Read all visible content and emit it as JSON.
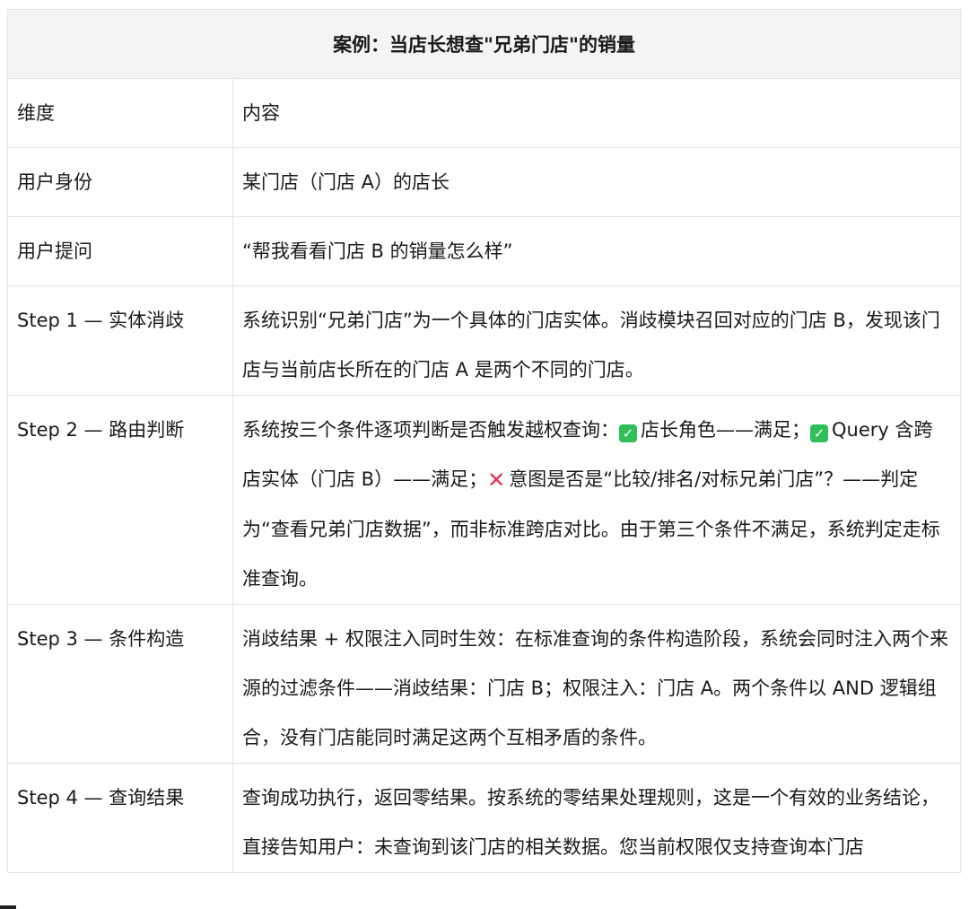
{
  "title": "案例：当店长想查\"兄弟门店\"的销量",
  "header": {
    "col1": "维度",
    "col2": "内容"
  },
  "rows": [
    {
      "label": "用户身份",
      "content": "某门店（门店 A）的店长"
    },
    {
      "label": "用户提问",
      "content": "“帮我看看门店 B 的销量怎么样”"
    },
    {
      "label": "Step 1 — 实体消歧",
      "content": "系统识别“兄弟门店”为一个具体的门店实体。消歧模块召回对应的门店 B，发现该门店与当前店长所在的门店 A 是两个不同的门店。"
    },
    {
      "label": "Step 2 — 路由判断",
      "part1": "系统按三个条件逐项判断是否触发越权查询：",
      "part2": "店长角色——满足；",
      "part3": "Query 含跨店实体（门店 B）——满足；",
      "part4": "意图是否是“比较/排名/对标兄弟门店”？——判定为“查看兄弟门店数据”，而非标准跨店对比。由于第三个条件不满足，系统判定走标准查询。"
    },
    {
      "label": "Step 3 — 条件构造",
      "content": "消歧结果 + 权限注入同时生效：在标准查询的条件构造阶段，系统会同时注入两个来源的过滤条件——消歧结果：门店 B；权限注入：门店 A。两个条件以 AND 逻辑组合，没有门店能同时满足这两个互相矛盾的条件。"
    },
    {
      "label": "Step 4 — 查询结果",
      "content": "查询成功执行，返回零结果。按系统的零结果处理规则，这是一个有效的业务结论，直接告知用户：未查询到该门店的相关数据。您当前权限仅支持查询本门店"
    }
  ],
  "icons": {
    "check": "check-mark-icon",
    "cross": "cross-mark-icon",
    "check_color": "#2fbf5a",
    "cross_color": "#e5304f"
  }
}
